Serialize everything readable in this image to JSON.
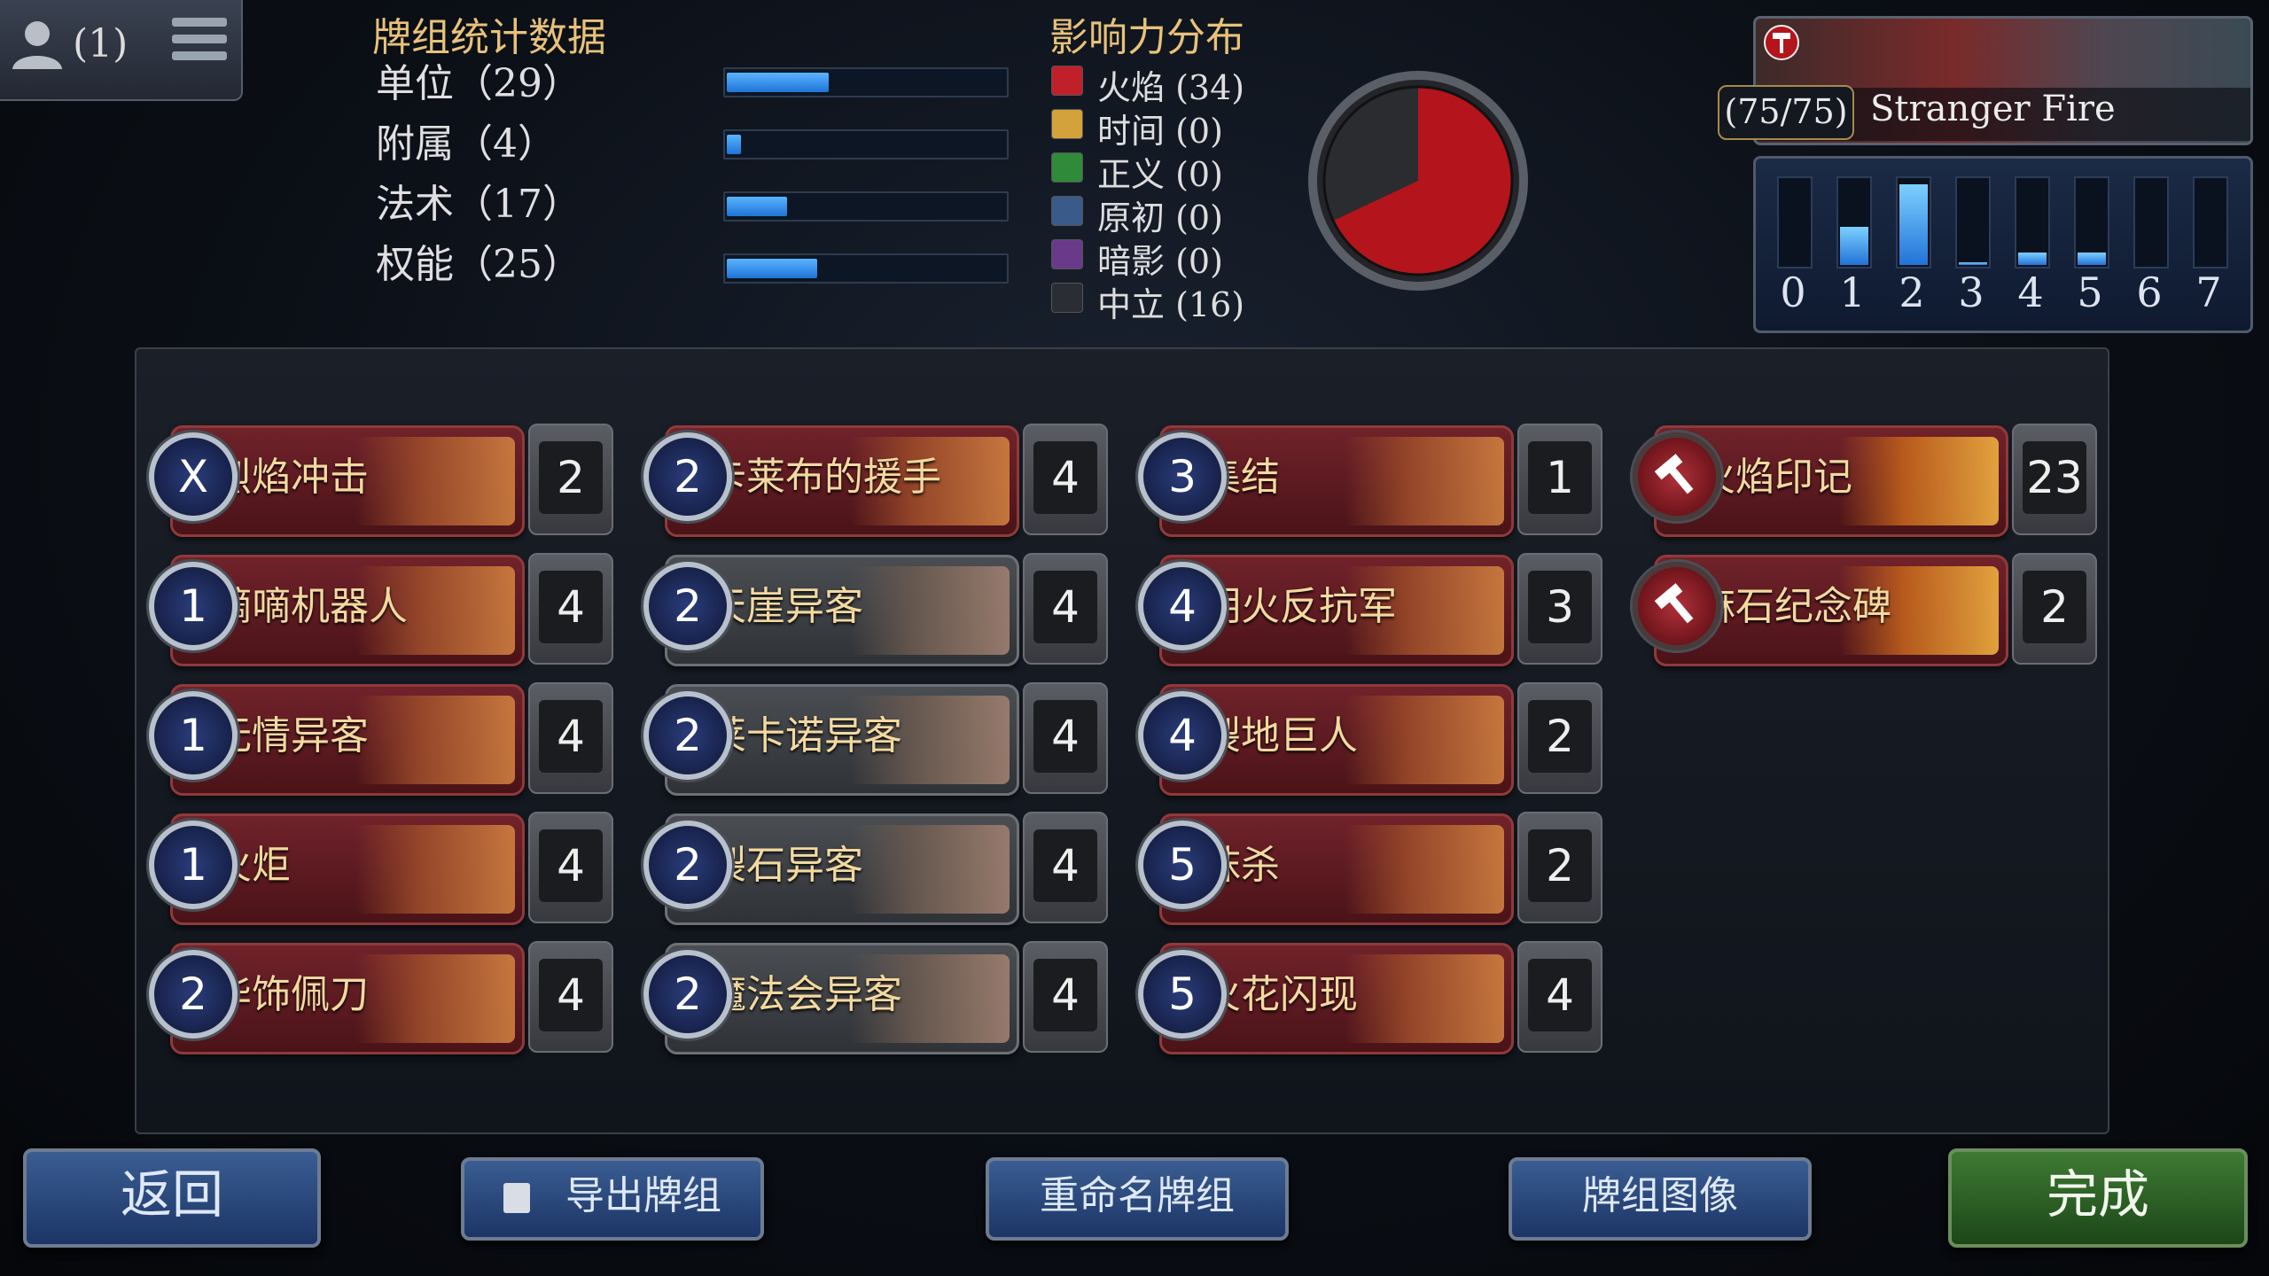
{
  "header": {
    "player_count": "(1)"
  },
  "stats": {
    "title": "牌组统计数据",
    "rows": [
      {
        "label": "单位（29）",
        "fill": 0.37
      },
      {
        "label": "附属（4）",
        "fill": 0.05
      },
      {
        "label": "法术（17）",
        "fill": 0.22
      },
      {
        "label": "权能（25）",
        "fill": 0.33
      }
    ]
  },
  "influence": {
    "title": "影响力分布",
    "rows": [
      {
        "label": "火焰 (34)",
        "color": "#c0202a"
      },
      {
        "label": "时间 (0)",
        "color": "#d4a23a"
      },
      {
        "label": "正义 (0)",
        "color": "#2f8a3a"
      },
      {
        "label": "原初 (0)",
        "color": "#3a5a8a"
      },
      {
        "label": "暗影 (0)",
        "color": "#6a3a8a"
      },
      {
        "label": "中立 (16)",
        "color": "#2a2d33"
      }
    ],
    "pie": {
      "fire": 34,
      "neutral": 16
    }
  },
  "deck": {
    "count": "(75/75)",
    "name": "Stranger Fire",
    "icon": "hammer-icon"
  },
  "curve": {
    "labels": [
      "0",
      "1",
      "2",
      "3",
      "4",
      "5",
      "6",
      "7"
    ],
    "levels": [
      0,
      0.45,
      0.95,
      0.03,
      0.15,
      0.15,
      0,
      0
    ]
  },
  "cards": [
    {
      "cost": "X",
      "name": "烈焰冲击",
      "qty": "2",
      "style": "red"
    },
    {
      "cost": "1",
      "name": "嘀嘀机器人",
      "qty": "4",
      "style": "red"
    },
    {
      "cost": "1",
      "name": "无情异客",
      "qty": "4",
      "style": "red"
    },
    {
      "cost": "1",
      "name": "火炬",
      "qty": "4",
      "style": "red"
    },
    {
      "cost": "2",
      "name": "华饰佩刀",
      "qty": "4",
      "style": "red"
    },
    {
      "cost": "2",
      "name": "卡莱布的援手",
      "qty": "4",
      "style": "red"
    },
    {
      "cost": "2",
      "name": "天崖异客",
      "qty": "4",
      "style": "gray"
    },
    {
      "cost": "2",
      "name": "莱卡诺异客",
      "qty": "4",
      "style": "gray"
    },
    {
      "cost": "2",
      "name": "裂石异客",
      "qty": "4",
      "style": "gray"
    },
    {
      "cost": "2",
      "name": "魔法会异客",
      "qty": "4",
      "style": "gray"
    },
    {
      "cost": "3",
      "name": "集结",
      "qty": "1",
      "style": "red"
    },
    {
      "cost": "4",
      "name": "明火反抗军",
      "qty": "3",
      "style": "red"
    },
    {
      "cost": "4",
      "name": "裂地巨人",
      "qty": "2",
      "style": "red"
    },
    {
      "cost": "5",
      "name": "抹杀",
      "qty": "2",
      "style": "red"
    },
    {
      "cost": "5",
      "name": "火花闪现",
      "qty": "4",
      "style": "red"
    },
    {
      "cost": "",
      "name": "火焰印记",
      "qty": "23",
      "style": "power"
    },
    {
      "cost": "",
      "name": "麻石纪念碑",
      "qty": "2",
      "style": "power"
    }
  ],
  "buttons": {
    "back": "返回",
    "export": "导出牌组",
    "rename": "重命名牌组",
    "image": "牌组图像",
    "done": "完成"
  }
}
